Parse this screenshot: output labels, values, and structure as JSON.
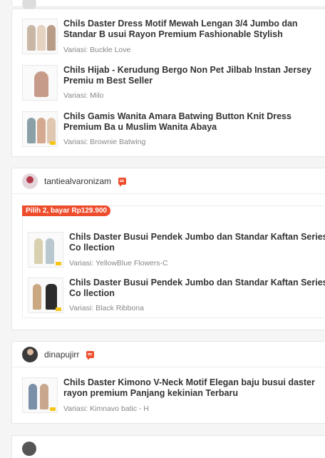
{
  "order1": {
    "items": [
      {
        "title": "Chils Daster Dress Motif Mewah Lengan 3/4 Jumbo dan Standar B usui Rayon Premium Fashionable Stylish",
        "variant": "Variasi: Buckle Love"
      },
      {
        "title": "Chils Hijab - Kerudung Bergo Non Pet Jilbab Instan Jersey Premiu m Best Seller",
        "variant": "Variasi: Milo"
      },
      {
        "title": "Chils Gamis Wanita Amara Batwing Button Knit Dress Premium Ba u Muslim Wanita Abaya",
        "variant": "Variasi: Brownie Batwing"
      }
    ]
  },
  "order2": {
    "username": "tantiealvaronizam",
    "promo": "Pilih 2, bayar Rp129.900",
    "items": [
      {
        "title": "Chils Daster Busui Pendek Jumbo dan Standar Kaftan Series Co llection",
        "variant": "Variasi: YellowBlue Flowers-C"
      },
      {
        "title": "Chils Daster Busui Pendek Jumbo dan Standar Kaftan Series Co llection",
        "variant": "Variasi: Black Ribbona"
      }
    ]
  },
  "order3": {
    "username": "dinapujirr",
    "items": [
      {
        "title": "Chils Daster Kimono V-Neck Motif Elegan baju busui daster rayon premium Panjang kekinian Terbaru",
        "variant": "Variasi: Kimnavo batic - H"
      }
    ]
  },
  "icons": {
    "chat": "chat-icon"
  },
  "colors": {
    "accent": "#ee4d2d"
  }
}
